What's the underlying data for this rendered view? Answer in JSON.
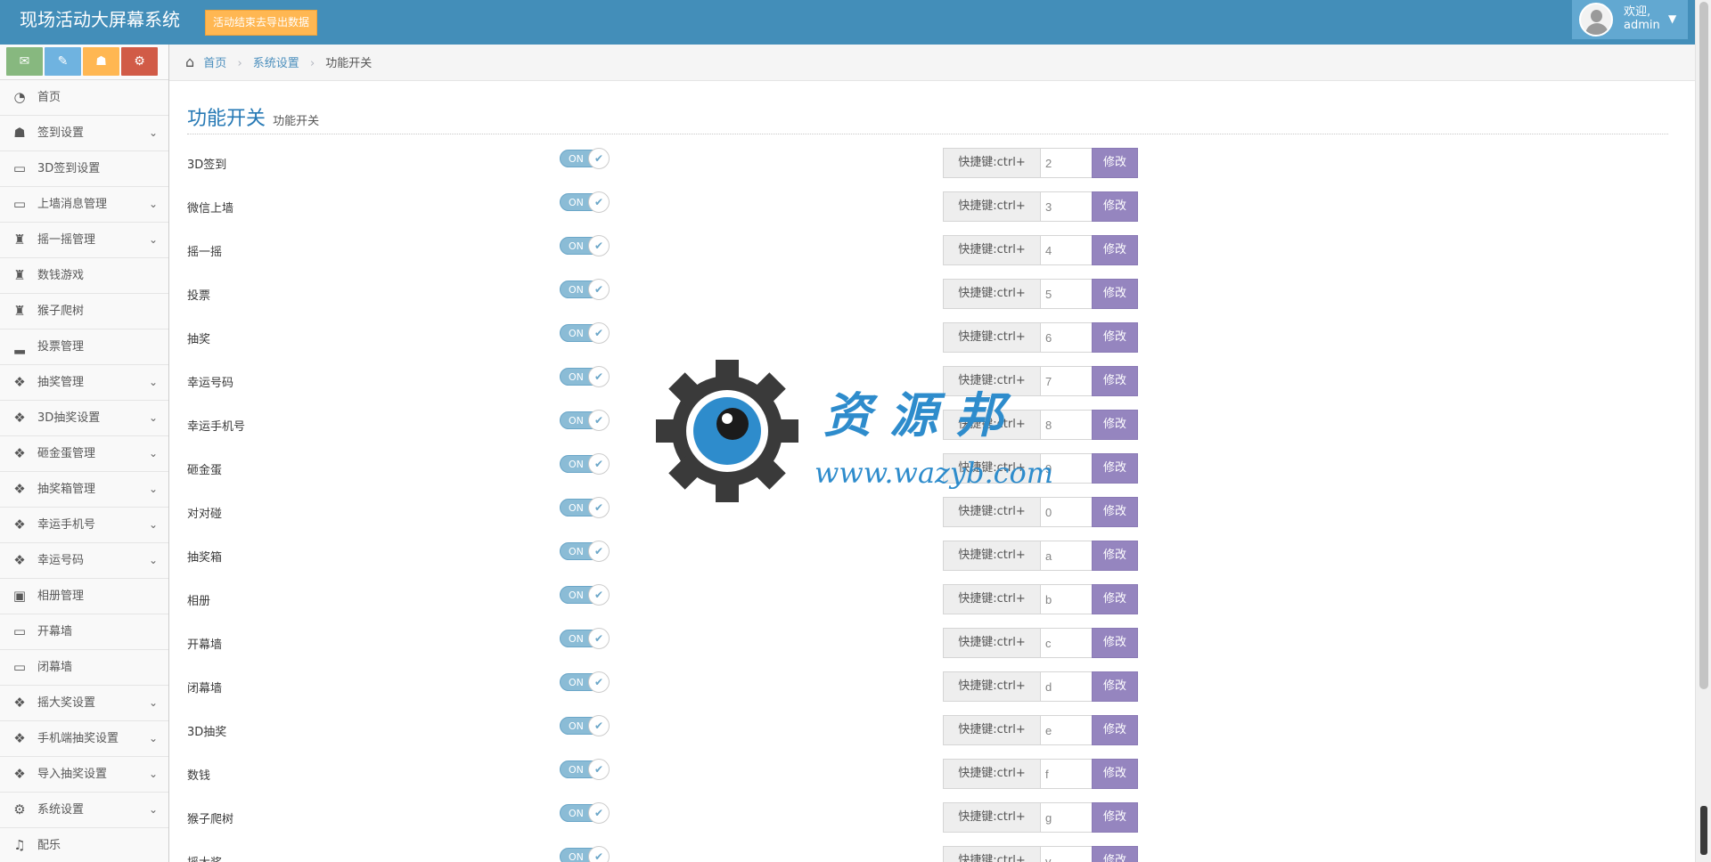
{
  "header": {
    "brand": "现场活动大屏幕系统",
    "notice_button": "活动结束去导出数据",
    "welcome": "欢迎,",
    "username": "admin"
  },
  "shortcuts": [
    {
      "icon": "comment-icon",
      "color": "#87b87f"
    },
    {
      "icon": "pencil-icon",
      "color": "#6fb3e0"
    },
    {
      "icon": "users-icon",
      "color": "#ffb752"
    },
    {
      "icon": "cogs-icon",
      "color": "#d15b47"
    }
  ],
  "sidebar": {
    "items": [
      {
        "label": "首页",
        "icon": "dashboard-icon",
        "has_submenu": false
      },
      {
        "label": "签到设置",
        "icon": "users-icon",
        "has_submenu": true
      },
      {
        "label": "3D签到设置",
        "icon": "desktop-icon",
        "has_submenu": false
      },
      {
        "label": "上墙消息管理",
        "icon": "desktop-icon",
        "has_submenu": true
      },
      {
        "label": "摇一摇管理",
        "icon": "trophy-icon",
        "has_submenu": true
      },
      {
        "label": "数钱游戏",
        "icon": "trophy-icon",
        "has_submenu": false
      },
      {
        "label": "猴子爬树",
        "icon": "trophy-icon",
        "has_submenu": false
      },
      {
        "label": "投票管理",
        "icon": "signal-icon",
        "has_submenu": false
      },
      {
        "label": "抽奖管理",
        "icon": "gift-icon",
        "has_submenu": true
      },
      {
        "label": "3D抽奖设置",
        "icon": "gift-icon",
        "has_submenu": true
      },
      {
        "label": "砸金蛋管理",
        "icon": "gift-icon",
        "has_submenu": true
      },
      {
        "label": "抽奖箱管理",
        "icon": "gift-icon",
        "has_submenu": true
      },
      {
        "label": "幸运手机号",
        "icon": "gift-icon",
        "has_submenu": true
      },
      {
        "label": "幸运号码",
        "icon": "gift-icon",
        "has_submenu": true
      },
      {
        "label": "相册管理",
        "icon": "picture-icon",
        "has_submenu": false
      },
      {
        "label": "开幕墙",
        "icon": "desktop-icon",
        "has_submenu": false
      },
      {
        "label": "闭幕墙",
        "icon": "desktop-icon",
        "has_submenu": false
      },
      {
        "label": "摇大奖设置",
        "icon": "gift-icon",
        "has_submenu": true
      },
      {
        "label": "手机端抽奖设置",
        "icon": "gift-icon",
        "has_submenu": true
      },
      {
        "label": "导入抽奖设置",
        "icon": "gift-icon",
        "has_submenu": true
      },
      {
        "label": "系统设置",
        "icon": "cog-icon",
        "has_submenu": true
      },
      {
        "label": "配乐",
        "icon": "music-icon",
        "has_submenu": false
      }
    ]
  },
  "breadcrumb": {
    "home": "首页",
    "section": "系统设置",
    "current": "功能开关"
  },
  "page": {
    "title": "功能开关",
    "subtitle": "功能开关"
  },
  "toggle_on_label": "ON",
  "hotkey_prefix": "快捷键:ctrl+",
  "modify_label": "修改",
  "features": [
    {
      "name": "3D签到",
      "key": "2",
      "enabled": true
    },
    {
      "name": "微信上墙",
      "key": "3",
      "enabled": true
    },
    {
      "name": "摇一摇",
      "key": "4",
      "enabled": true
    },
    {
      "name": "投票",
      "key": "5",
      "enabled": true
    },
    {
      "name": "抽奖",
      "key": "6",
      "enabled": true
    },
    {
      "name": "幸运号码",
      "key": "7",
      "enabled": true
    },
    {
      "name": "幸运手机号",
      "key": "8",
      "enabled": true
    },
    {
      "name": "砸金蛋",
      "key": "9",
      "enabled": true
    },
    {
      "name": "对对碰",
      "key": "0",
      "enabled": true
    },
    {
      "name": "抽奖箱",
      "key": "a",
      "enabled": true
    },
    {
      "name": "相册",
      "key": "b",
      "enabled": true
    },
    {
      "name": "开幕墙",
      "key": "c",
      "enabled": true
    },
    {
      "name": "闭幕墙",
      "key": "d",
      "enabled": true
    },
    {
      "name": "3D抽奖",
      "key": "e",
      "enabled": true
    },
    {
      "name": "数钱",
      "key": "f",
      "enabled": true
    },
    {
      "name": "猴子爬树",
      "key": "g",
      "enabled": true
    },
    {
      "name": "摇大奖",
      "key": "v",
      "enabled": true
    }
  ],
  "watermark": {
    "text": "资源邦",
    "url": "www.wazyb.com"
  },
  "colors": {
    "navbar": "#438eb9",
    "notice": "#ffb752",
    "toggle": "#8bbcd6",
    "modify_button": "#9585bf",
    "title": "#2679b5"
  }
}
